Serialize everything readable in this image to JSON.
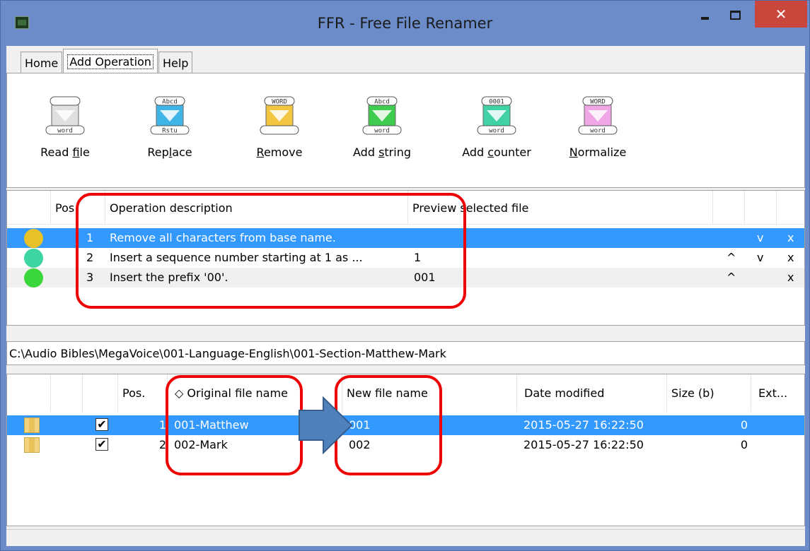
{
  "window": {
    "title": "FFR - Free File Renamer",
    "close_glyph": "✕"
  },
  "tabs": [
    {
      "label": "Home",
      "active": false
    },
    {
      "label": "Add Operation",
      "active": true
    },
    {
      "label": "Help",
      "active": false
    }
  ],
  "ribbon": {
    "buttons": [
      {
        "label_pre": "Read ",
        "label_ul": "f",
        "label_post": "ile",
        "icon": "read-file-icon",
        "top_text": "",
        "bottom_text": "word",
        "color": "#e0e0e0"
      },
      {
        "label_pre": "Rep",
        "label_ul": "l",
        "label_post": "ace",
        "icon": "replace-icon",
        "top_text": "Abcd",
        "bottom_text": "Rstu",
        "color": "#3fb4e6"
      },
      {
        "label_pre": "",
        "label_ul": "R",
        "label_post": "emove",
        "icon": "remove-icon",
        "top_text": "WORD",
        "bottom_text": "",
        "color": "#f2c640"
      },
      {
        "label_pre": "Add ",
        "label_ul": "s",
        "label_post": "tring",
        "icon": "add-string-icon",
        "top_text": "Abcd",
        "bottom_text": "word",
        "color": "#3fcc4e"
      },
      {
        "label_pre": "Add ",
        "label_ul": "c",
        "label_post": "ounter",
        "icon": "add-counter-icon",
        "top_text": "0001",
        "bottom_text": "word",
        "color": "#40d2a6"
      },
      {
        "label_pre": "",
        "label_ul": "N",
        "label_post": "ormalize",
        "icon": "normalize-icon",
        "top_text": "WORD",
        "bottom_text": "word",
        "color": "#f0a6e6"
      }
    ]
  },
  "operations": {
    "headers": {
      "pos": "Pos.",
      "description": "Operation description",
      "preview": "Preview selected file"
    },
    "rows": [
      {
        "pos": "1",
        "description": "Remove all characters from base name.",
        "preview": "",
        "up": "",
        "down": "v",
        "remove": "x",
        "status_color": "#e8c12a",
        "selected": true
      },
      {
        "pos": "2",
        "description": "Insert a sequence number starting at 1 as ...",
        "preview": "1",
        "up": "^",
        "down": "v",
        "remove": "x",
        "status_color": "#3dd6a0",
        "selected": false
      },
      {
        "pos": "3",
        "description": "Insert the prefix '00'.",
        "preview": "001",
        "up": "^",
        "down": "",
        "remove": "x",
        "status_color": "#3ad63a",
        "selected": false
      }
    ]
  },
  "path": "C:\\Audio Bibles\\MegaVoice\\001-Language-English\\001-Section-Matthew-Mark",
  "files": {
    "headers": {
      "pos": "Pos.",
      "original": "◇ Original file name",
      "new": "New file name",
      "date": "Date modified",
      "size": "Size (b)",
      "ext": "Ext..."
    },
    "rows": [
      {
        "pos": "1",
        "checked": "✔",
        "original": "001-Matthew",
        "new": "001",
        "date": "2015-05-27 16:22:50",
        "size": "0",
        "selected": true
      },
      {
        "pos": "2",
        "checked": "✔",
        "original": "002-Mark",
        "new": "002",
        "date": "2015-05-27 16:22:50",
        "size": "0",
        "selected": false
      }
    ]
  },
  "colors": {
    "selection": "#3399ff",
    "annotation": "#ee0000",
    "arrow": "#4f81bd"
  }
}
